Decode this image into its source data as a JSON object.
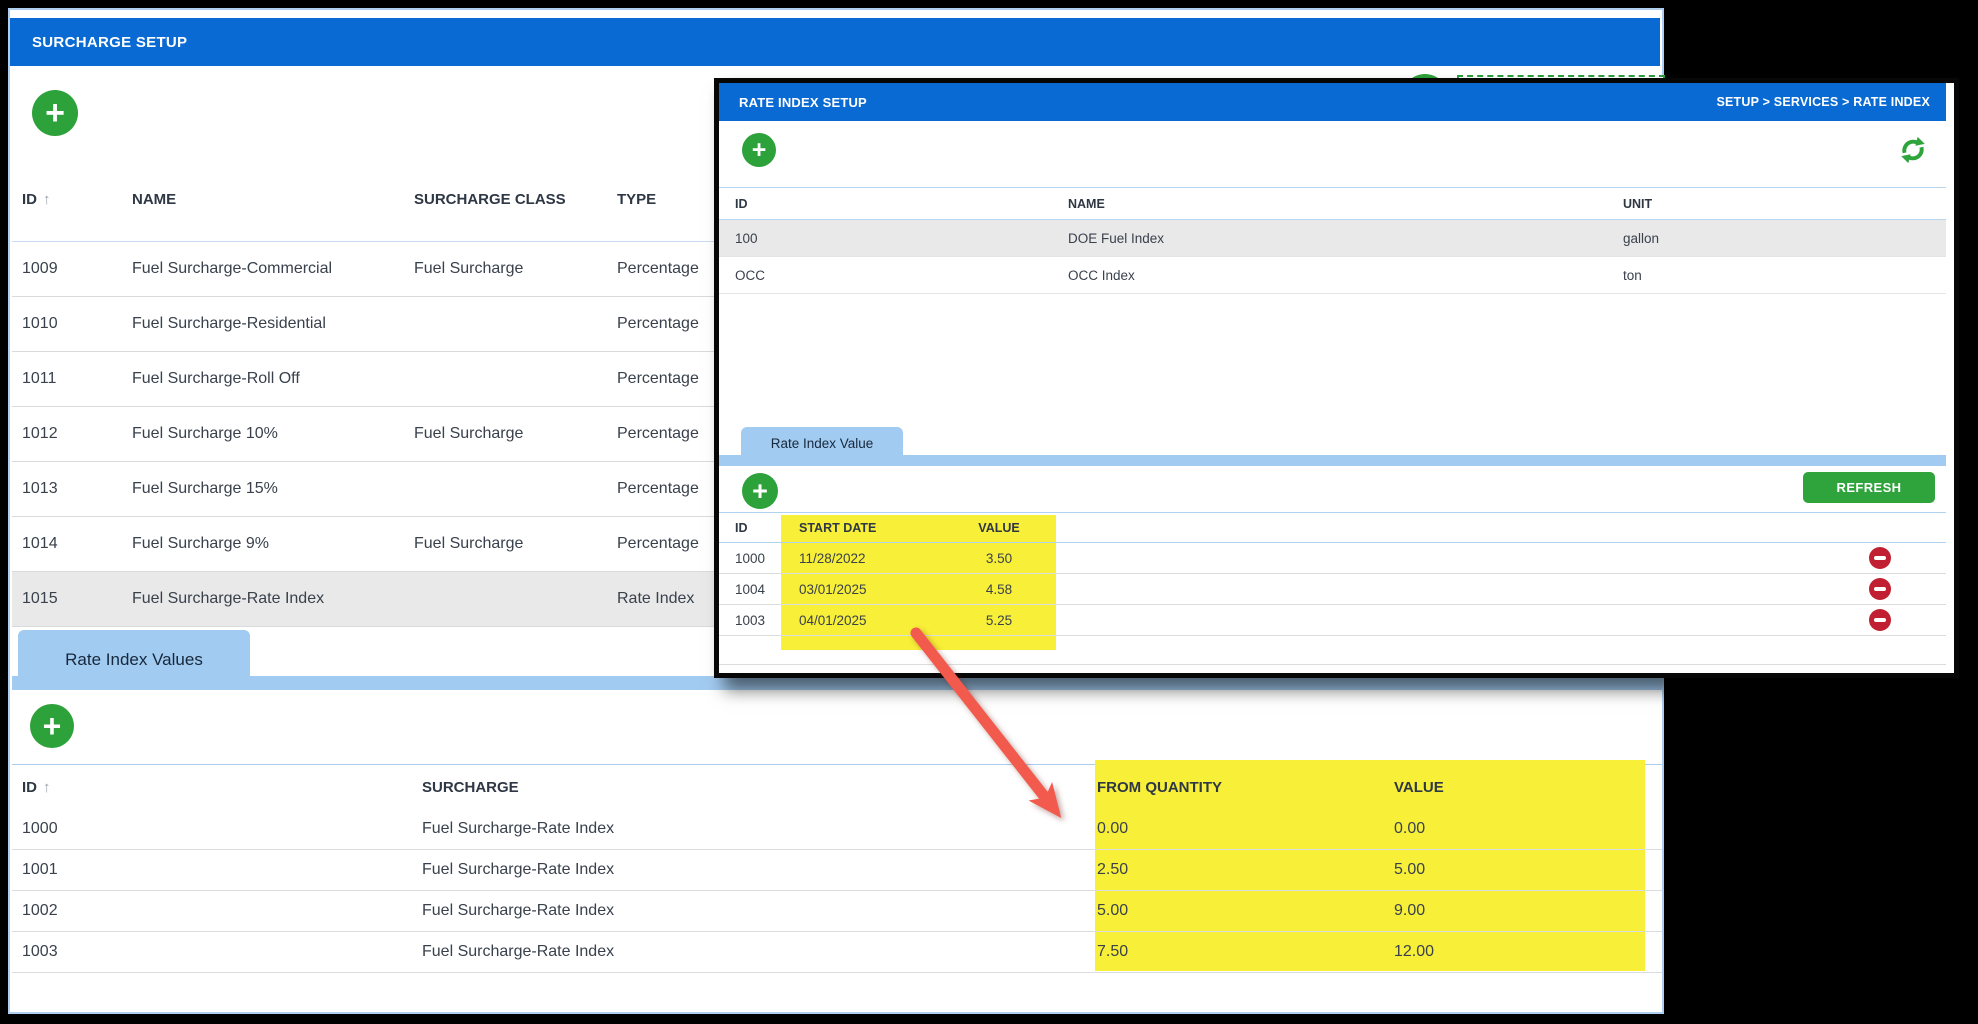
{
  "colors": {
    "title_bar_blue": "#0a6ad3",
    "tab_blue": "#a2cbf1",
    "highlight_yellow": "#f8ef38",
    "action_green": "#2da13a",
    "delete_red": "#c02031",
    "arrow_red": "#f25a4d",
    "selected_row_gray": "#e9e9e9"
  },
  "icons": {
    "plus": "+",
    "sort_ascending": "↑"
  },
  "surcharge_window": {
    "title": "SURCHARGE SETUP",
    "table": {
      "columns": {
        "id": "ID",
        "name": "NAME",
        "surcharge_class": "SURCHARGE CLASS",
        "type": "TYPE"
      },
      "rows": [
        {
          "id": "1009",
          "name": "Fuel Surcharge-Commercial",
          "surcharge_class": "Fuel Surcharge",
          "type": "Percentage"
        },
        {
          "id": "1010",
          "name": "Fuel Surcharge-Residential",
          "surcharge_class": "",
          "type": "Percentage"
        },
        {
          "id": "1011",
          "name": "Fuel Surcharge-Roll Off",
          "surcharge_class": "",
          "type": "Percentage"
        },
        {
          "id": "1012",
          "name": "Fuel Surcharge 10%",
          "surcharge_class": "Fuel Surcharge",
          "type": "Percentage"
        },
        {
          "id": "1013",
          "name": "Fuel Surcharge 15%",
          "surcharge_class": "",
          "type": "Percentage"
        },
        {
          "id": "1014",
          "name": "Fuel Surcharge 9%",
          "surcharge_class": "Fuel Surcharge",
          "type": "Percentage"
        },
        {
          "id": "1015",
          "name": "Fuel Surcharge-Rate Index",
          "surcharge_class": "",
          "type": "Rate Index"
        }
      ]
    },
    "values_tab": "Rate Index Values",
    "values_table": {
      "columns": {
        "id": "ID",
        "surcharge": "SURCHARGE",
        "from_quantity": "FROM QUANTITY",
        "value": "VALUE"
      },
      "rows": [
        {
          "id": "1000",
          "surcharge": "Fuel Surcharge-Rate Index",
          "from_quantity": "0.00",
          "value": "0.00"
        },
        {
          "id": "1001",
          "surcharge": "Fuel Surcharge-Rate Index",
          "from_quantity": "2.50",
          "value": "5.00"
        },
        {
          "id": "1002",
          "surcharge": "Fuel Surcharge-Rate Index",
          "from_quantity": "5.00",
          "value": "9.00"
        },
        {
          "id": "1003",
          "surcharge": "Fuel Surcharge-Rate Index",
          "from_quantity": "7.50",
          "value": "12.00"
        }
      ]
    }
  },
  "rate_index_window": {
    "title": "RATE INDEX SETUP",
    "breadcrumb": "SETUP > SERVICES > RATE INDEX",
    "index_table": {
      "columns": {
        "id": "ID",
        "name": "NAME",
        "unit": "UNIT"
      },
      "rows": [
        {
          "id": "100",
          "name": "DOE Fuel Index",
          "unit": "gallon"
        },
        {
          "id": "OCC",
          "name": "OCC Index",
          "unit": "ton"
        }
      ]
    },
    "tab": "Rate Index Value",
    "refresh_button": "REFRESH",
    "value_table": {
      "columns": {
        "id": "ID",
        "start_date": "START DATE",
        "value": "VALUE"
      },
      "rows": [
        {
          "id": "1000",
          "start_date": "11/28/2022",
          "value": "3.50"
        },
        {
          "id": "1004",
          "start_date": "03/01/2025",
          "value": "4.58"
        },
        {
          "id": "1003",
          "start_date": "04/01/2025",
          "value": "5.25"
        }
      ]
    }
  }
}
